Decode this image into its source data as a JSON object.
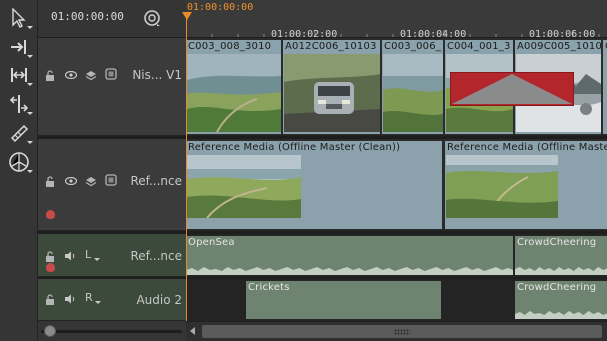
{
  "header": {
    "timecode": "01:00:00:00",
    "playhead_timecode": "01:00:00:00",
    "ruler_labels": [
      "01:00:02:00",
      "01:00:04:00",
      "01:00:06:00"
    ]
  },
  "toolbar": {
    "tools": [
      {
        "name": "select-tool-icon"
      },
      {
        "name": "track-select-tool-icon"
      },
      {
        "name": "ripple-tool-icon"
      },
      {
        "name": "slip-tool-icon"
      },
      {
        "name": "razor-tool-icon"
      },
      {
        "name": "retime-tool-icon"
      }
    ]
  },
  "tracks": {
    "video1": {
      "name": "Nis... V1",
      "clips": [
        "C003_008_3010",
        "A012C006_10103",
        "C003_006_",
        "C004_001_3",
        "A009C005_1010",
        "C"
      ]
    },
    "reference": {
      "name": "Ref...nce",
      "clips": [
        "Reference Media (Offline Master (Clean))",
        "Reference Media (Offline Master (Cl"
      ]
    },
    "audio_ref": {
      "name": "Ref...nce",
      "channel": "L",
      "clips": [
        "OpenSea",
        "CrowdCheering"
      ]
    },
    "audio2": {
      "name": "Audio 2",
      "channel": "R",
      "clips": [
        "Crickets",
        "CrowdCheering"
      ]
    }
  },
  "colors": {
    "playhead": "#e8892a",
    "video_clip": "#8aa2ac",
    "audio_clip": "#6e8470",
    "offline_red": "#b3262c"
  }
}
